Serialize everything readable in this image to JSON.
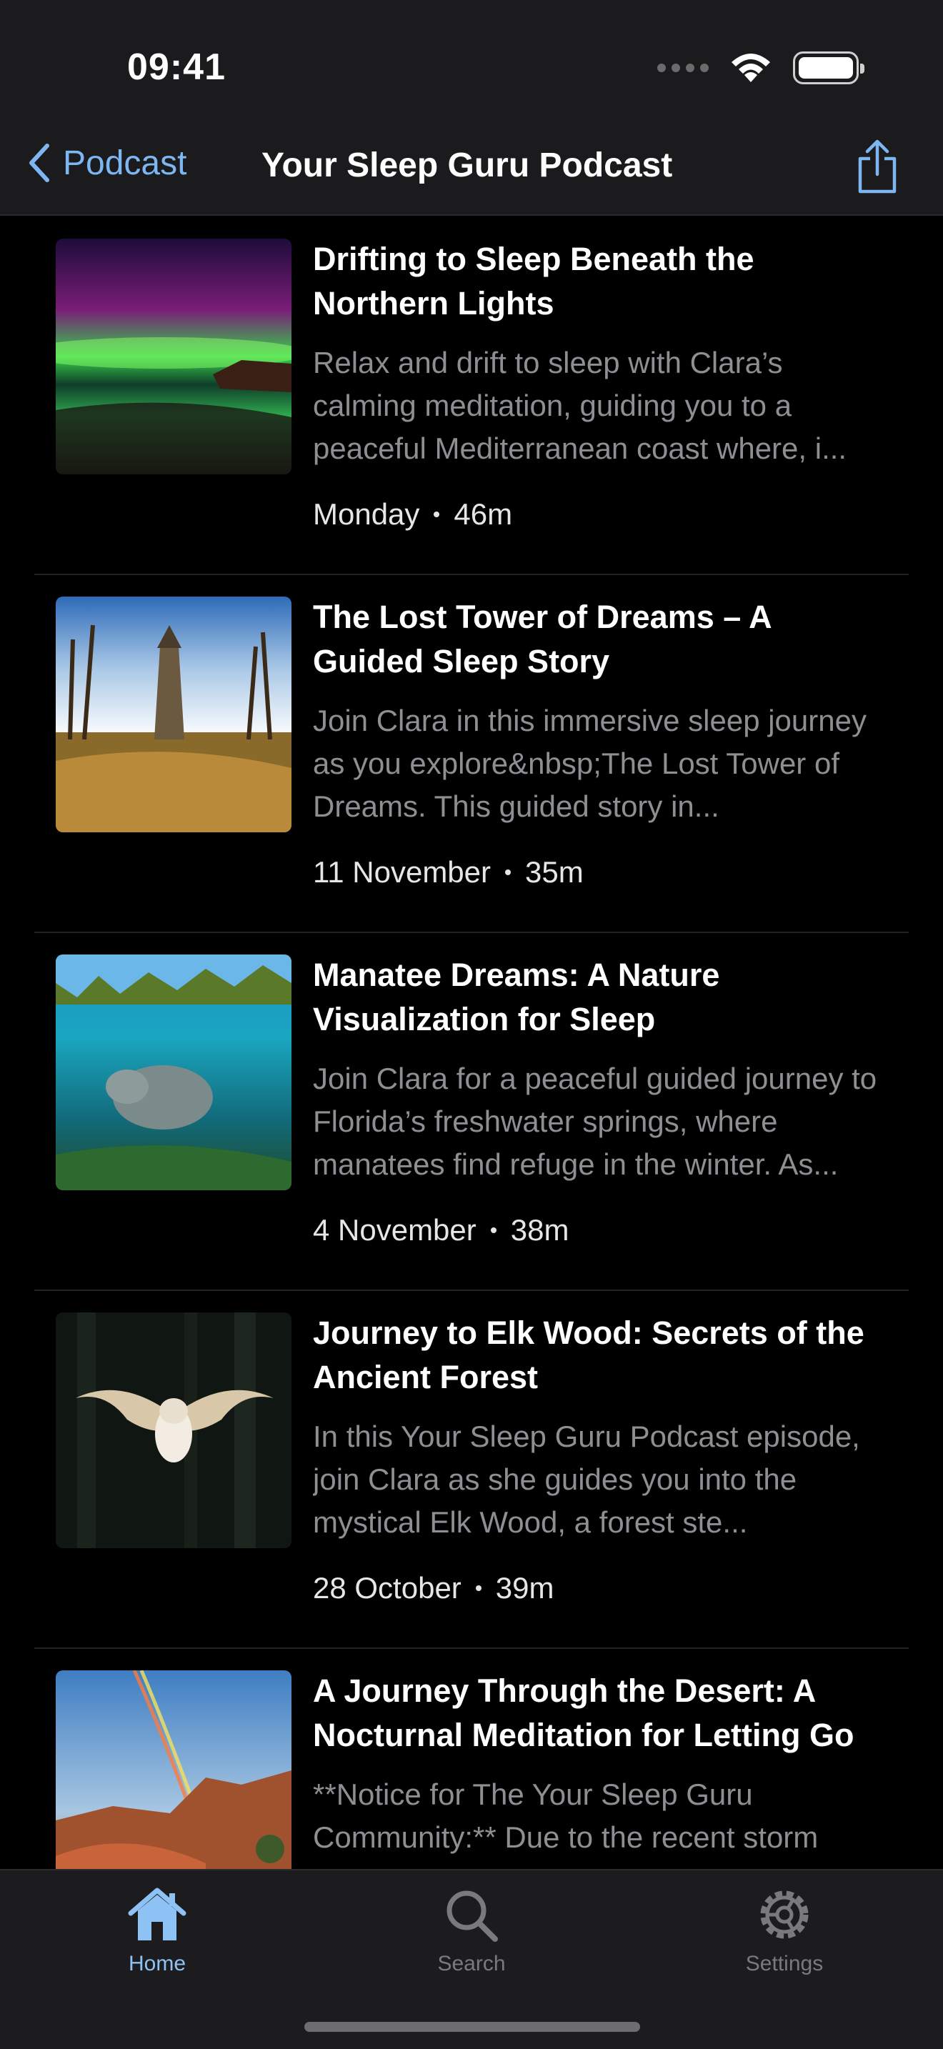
{
  "status_bar": {
    "time": "09:41"
  },
  "nav": {
    "back_label": "Podcast",
    "title": "Your Sleep Guru Podcast"
  },
  "episodes": [
    {
      "title": "Drifting to Sleep Beneath the Northern Lights",
      "description": "Relax and drift to sleep with Clara’s calming meditation, guiding you to a peaceful Mediterranean coast where, i...",
      "date": "Monday",
      "duration": "46m"
    },
    {
      "title": "The Lost Tower of Dreams – A Guided Sleep Story",
      "description": "Join Clara in this immersive sleep journey as you explore&nbsp;The Lost Tower of Dreams. This guided story in...",
      "date": "11 November",
      "duration": "35m"
    },
    {
      "title": "Manatee Dreams: A Nature Visualization for Sleep",
      "description": "Join Clara for a peaceful guided journey to Florida’s freshwater springs, where manatees find refuge in the winter. As...",
      "date": "4 November",
      "duration": "38m"
    },
    {
      "title": "Journey to Elk Wood: Secrets of the Ancient Forest",
      "description": "In this Your Sleep Guru Podcast episode, join Clara as she guides you into the mystical Elk Wood, a forest ste...",
      "date": "28 October",
      "duration": "39m"
    },
    {
      "title": "A Journey Through the Desert: A Nocturnal Meditation for Letting Go",
      "description": "**Notice for The Your Sleep Guru Community:** Due to the recent storm",
      "date": "",
      "duration": ""
    }
  ],
  "tabs": [
    {
      "label": "Home",
      "icon": "house-icon",
      "active": true
    },
    {
      "label": "Search",
      "icon": "magnifier-icon",
      "active": false
    },
    {
      "label": "Settings",
      "icon": "gear-icon",
      "active": false
    }
  ],
  "colors": {
    "accent": "#7eb6f2",
    "secondary_text": "#8e8e93",
    "background": "#000000",
    "bar": "#1c1c1e"
  }
}
